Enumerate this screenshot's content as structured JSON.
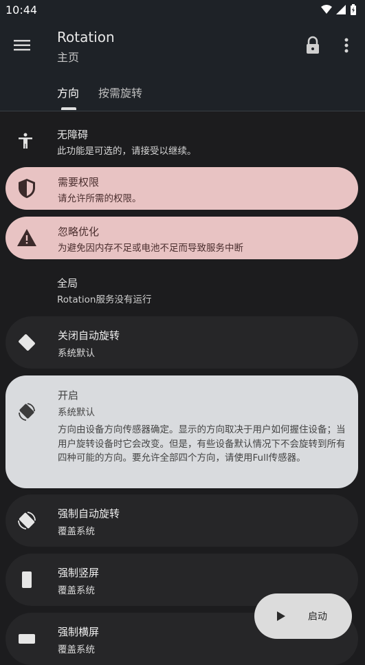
{
  "status_bar": {
    "time": "10:44"
  },
  "app_bar": {
    "title": "Rotation",
    "subtitle": "主页"
  },
  "tabs": [
    {
      "label": "方向"
    },
    {
      "label": "按需旋转"
    }
  ],
  "items": [
    {
      "title": "无障碍",
      "subtitle": "此功能是可选的，请接受以继续。",
      "icon": "accessibility-icon"
    },
    {
      "title": "需要权限",
      "subtitle": "请允许所需的权限。",
      "icon": "shield-icon"
    },
    {
      "title": "忽略优化",
      "subtitle": "为避免因内存不足或电池不足而导致服务中断",
      "icon": "warning-icon"
    },
    {
      "title": "全局",
      "subtitle": "Rotation服务没有运行"
    },
    {
      "title": "关闭自动旋转",
      "subtitle": "系统默认",
      "icon": "rotation-lock-icon"
    },
    {
      "title": "开启",
      "subtitle": "系统默认",
      "description": "方向由设备方向传感器确定。显示的方向取决于用户如何握住设备；当用户旋转设备时它会改变。但是，有些设备默认情况下不会旋转到所有四种可能的方向。要允许全部四个方向，请使用Full传感器。",
      "icon": "rotation-on-icon"
    },
    {
      "title": "强制自动旋转",
      "subtitle": "覆盖系统",
      "icon": "force-rotate-icon"
    },
    {
      "title": "强制竖屏",
      "subtitle": "覆盖系统",
      "icon": "portrait-icon"
    },
    {
      "title": "强制横屏",
      "subtitle": "覆盖系统",
      "icon": "landscape-icon"
    }
  ],
  "fab": {
    "label": "启动",
    "icon": "play-icon"
  },
  "colors": {
    "warning_card": "#e8c3c3",
    "selected_card": "#d9dbde",
    "app_bar": "#1e2227",
    "background": "#1c1c1e"
  }
}
